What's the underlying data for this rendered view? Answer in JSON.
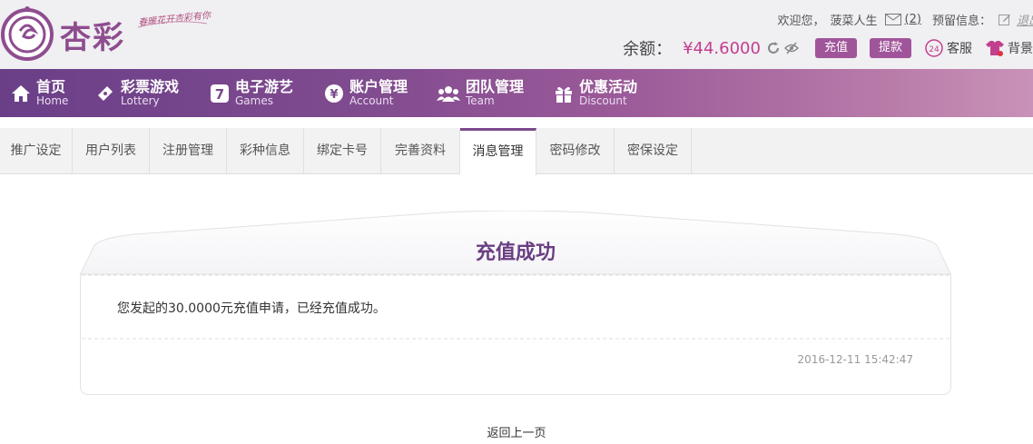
{
  "header": {
    "brand": "杏彩",
    "slogan": "春暖花开杏彩有你",
    "welcome": "欢迎您，",
    "username": "菠菜人生",
    "mail_count": "(2)",
    "reserve_label": "预留信息：",
    "logout": "退出",
    "balance_label": "余额：",
    "balance_value": "¥44.6000",
    "recharge_button": "充值",
    "withdraw_button": "提款",
    "service_label": "客服",
    "background_label": "背景",
    "accent_color": "#a0559a"
  },
  "nav": {
    "items": [
      {
        "zh": "首页",
        "en": "Home",
        "icon": "home-icon"
      },
      {
        "zh": "彩票游戏",
        "en": "Lottery",
        "icon": "ticket-icon"
      },
      {
        "zh": "电子游艺",
        "en": "Games",
        "icon": "seven-icon"
      },
      {
        "zh": "账户管理",
        "en": "Account",
        "icon": "yen-icon"
      },
      {
        "zh": "团队管理",
        "en": "Team",
        "icon": "team-icon"
      },
      {
        "zh": "优惠活动",
        "en": "Discount",
        "icon": "gift-icon"
      }
    ]
  },
  "tabs": {
    "items": [
      "推广设定",
      "用户列表",
      "注册管理",
      "彩种信息",
      "绑定卡号",
      "完善资料",
      "消息管理",
      "密码修改",
      "密保设定"
    ],
    "active": "消息管理"
  },
  "message": {
    "title": "充值成功",
    "body": "您发起的30.0000元充值申请，已经充值成功。",
    "timestamp": "2016-12-11 15:42:47"
  },
  "back_link": "返回上一页"
}
